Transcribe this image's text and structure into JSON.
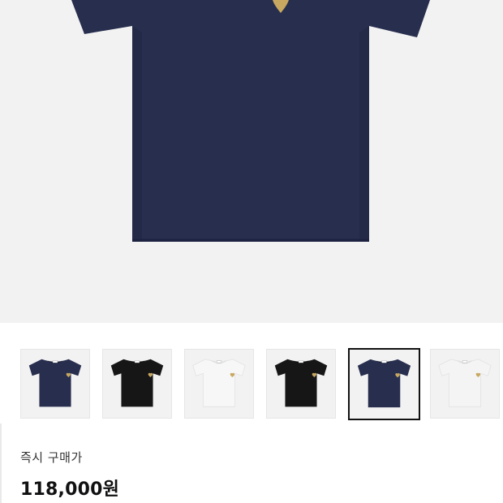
{
  "hero": {
    "shirt_color": "#272e4e",
    "heart_color": "#c8a860",
    "background": "#f2f2f2"
  },
  "thumbnails": [
    {
      "shirt_color": "#272e4e",
      "selected": false
    },
    {
      "shirt_color": "#161616",
      "selected": false
    },
    {
      "shirt_color": "#f7f7f7",
      "selected": false
    },
    {
      "shirt_color": "#161616",
      "selected": false
    },
    {
      "shirt_color": "#272e4e",
      "selected": true
    },
    {
      "shirt_color": "#f4f4f4",
      "selected": false
    }
  ],
  "price": {
    "label": "즉시 구매가",
    "value": "118,000원"
  }
}
